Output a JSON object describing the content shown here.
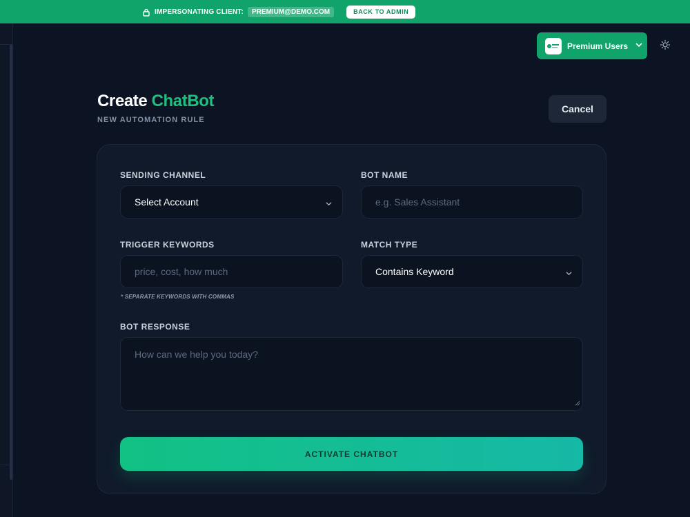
{
  "banner": {
    "label": "IMPERSONATING CLIENT:",
    "email": "PREMIUM@DEMO.COM",
    "back_label": "BACK TO ADMIN",
    "lock_icon": "lock-icon"
  },
  "header": {
    "workspace_label": "Premium Users",
    "workspace_logo_icon": "workspace-logo-icon",
    "theme_icon": "sun-icon"
  },
  "page": {
    "title_prefix": "Create",
    "title_accent": "ChatBot",
    "subtitle": "NEW AUTOMATION RULE",
    "cancel_label": "Cancel"
  },
  "form": {
    "channel": {
      "label": "SENDING CHANNEL",
      "value": "Select Account"
    },
    "bot_name": {
      "label": "BOT NAME",
      "placeholder": "e.g. Sales Assistant"
    },
    "keywords": {
      "label": "TRIGGER KEYWORDS",
      "placeholder": "price, cost, how much",
      "hint": "* SEPARATE KEYWORDS WITH COMMAS"
    },
    "match_type": {
      "label": "MATCH TYPE",
      "value": "Contains Keyword"
    },
    "response": {
      "label": "BOT RESPONSE",
      "placeholder": "How can we help you today?"
    },
    "submit_label": "ACTIVATE CHATBOT"
  },
  "colors": {
    "accent": "#10a36a",
    "background": "#0c1322",
    "card": "#101a2a",
    "gradient_start": "#12c184",
    "gradient_end": "#16b8a6"
  }
}
